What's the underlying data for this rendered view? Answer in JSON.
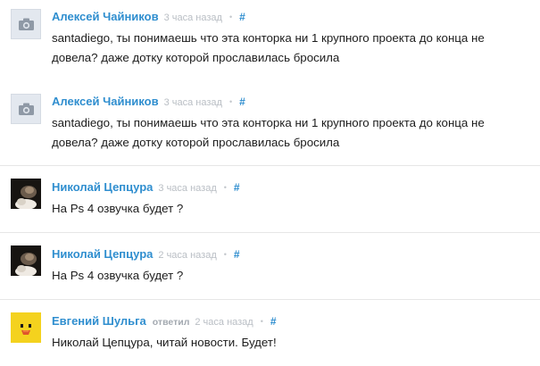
{
  "comments": [
    {
      "author": "Алексей Чайников",
      "time": "3 часа назад",
      "dot": "•",
      "hash": "#",
      "avatar": "camera-placeholder-icon",
      "text": "santadiego, ты понимаешь что эта конторка ни 1 крупного проекта до конца не довела? даже дотку которой прославилась бросила"
    },
    {
      "author": "Алексей Чайников",
      "time": "3 часа назад",
      "dot": "•",
      "hash": "#",
      "avatar": "camera-placeholder-icon",
      "text": "santadiego, ты понимаешь что эта конторка ни 1 крупного проекта до конца не довела? даже дотку которой прославилась бросила"
    },
    {
      "author": "Николай Цепцура",
      "time": "3 часа назад",
      "dot": "•",
      "hash": "#",
      "avatar": "user-photo",
      "text": "На Ps 4 озвучка будет ?"
    },
    {
      "author": "Николай Цепцура",
      "time": "2 часа назад",
      "dot": "•",
      "hash": "#",
      "avatar": "user-photo",
      "text": "На Ps 4 озвучка будет ?"
    },
    {
      "author": "Евгений Шульга",
      "replied": "ответил",
      "time": "2 часа назад",
      "dot": "•",
      "hash": "#",
      "avatar": "duck-avatar",
      "text": "Николай Цепцура, читай новости. Будет!"
    }
  ],
  "colors": {
    "author": "#2f8ecf",
    "meta": "#b9bec4",
    "text": "#1c1c1c",
    "divider": "#e6e6e6"
  }
}
